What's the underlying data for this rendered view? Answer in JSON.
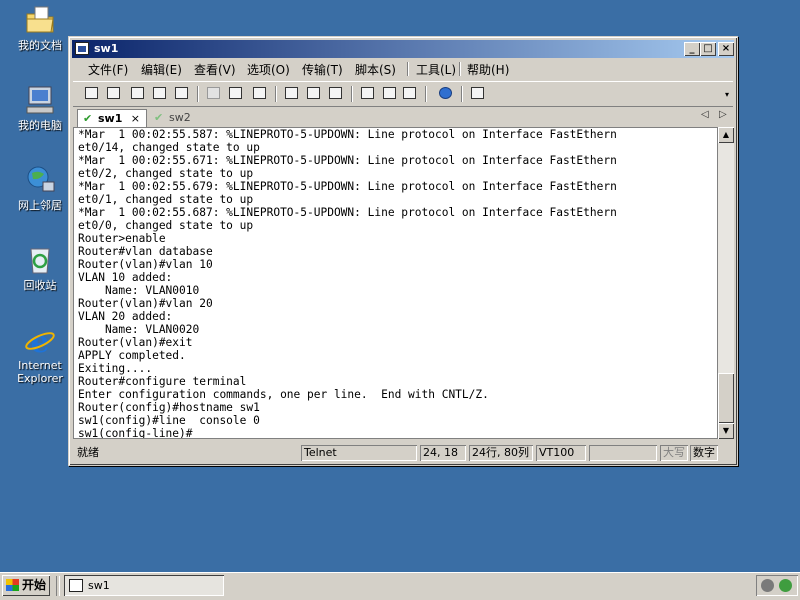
{
  "desktop": {
    "icons": [
      {
        "label": "我的文档",
        "icon": "my-documents-icon"
      },
      {
        "label": "我的电脑",
        "icon": "my-computer-icon"
      },
      {
        "label": "网上邻居",
        "icon": "network-places-icon"
      },
      {
        "label": "回收站",
        "icon": "recycle-bin-icon"
      },
      {
        "label": "Internet Explorer",
        "icon": "internet-explorer-icon"
      }
    ]
  },
  "window": {
    "title": "sw1",
    "menu": [
      "文件(F)",
      "编辑(E)",
      "查看(V)",
      "选项(O)",
      "传输(T)",
      "脚本(S)",
      "工具(L)",
      "帮助(H)"
    ],
    "tabs": [
      {
        "label": "sw1",
        "active": true,
        "close": "×"
      },
      {
        "label": "sw2",
        "active": false
      }
    ],
    "tab_nav": {
      "prev": "◁",
      "next": "▷"
    },
    "terminal_lines": [
      "*Mar  1 00:02:55.587: %LINEPROTO-5-UPDOWN: Line protocol on Interface FastEthern",
      "et0/14, changed state to up",
      "*Mar  1 00:02:55.671: %LINEPROTO-5-UPDOWN: Line protocol on Interface FastEthern",
      "et0/2, changed state to up",
      "*Mar  1 00:02:55.679: %LINEPROTO-5-UPDOWN: Line protocol on Interface FastEthern",
      "et0/1, changed state to up",
      "*Mar  1 00:02:55.687: %LINEPROTO-5-UPDOWN: Line protocol on Interface FastEthern",
      "et0/0, changed state to up",
      "Router>enable",
      "Router#vlan database",
      "Router(vlan)#vlan 10",
      "VLAN 10 added:",
      "    Name: VLAN0010",
      "Router(vlan)#vlan 20",
      "VLAN 20 added:",
      "    Name: VLAN0020",
      "Router(vlan)#exit",
      "APPLY completed.",
      "Exiting....",
      "Router#configure terminal",
      "Enter configuration commands, one per line.  End with CNTL/Z.",
      "Router(config)#hostname sw1",
      "sw1(config)#line  console 0",
      "sw1(config-line)#"
    ],
    "status": {
      "ready": "就绪",
      "protocol": "Telnet",
      "cursor": "24, 18",
      "size": "24行, 80列",
      "emulation": "VT100",
      "empty": "",
      "caps": "大写",
      "num": "数字"
    }
  },
  "taskbar": {
    "start": "开始",
    "task": "sw1"
  },
  "colors": {
    "desktop": "#3a6ea5",
    "title_start": "#0a246a",
    "title_end": "#a6caf0",
    "chrome": "#d4d0c8"
  }
}
